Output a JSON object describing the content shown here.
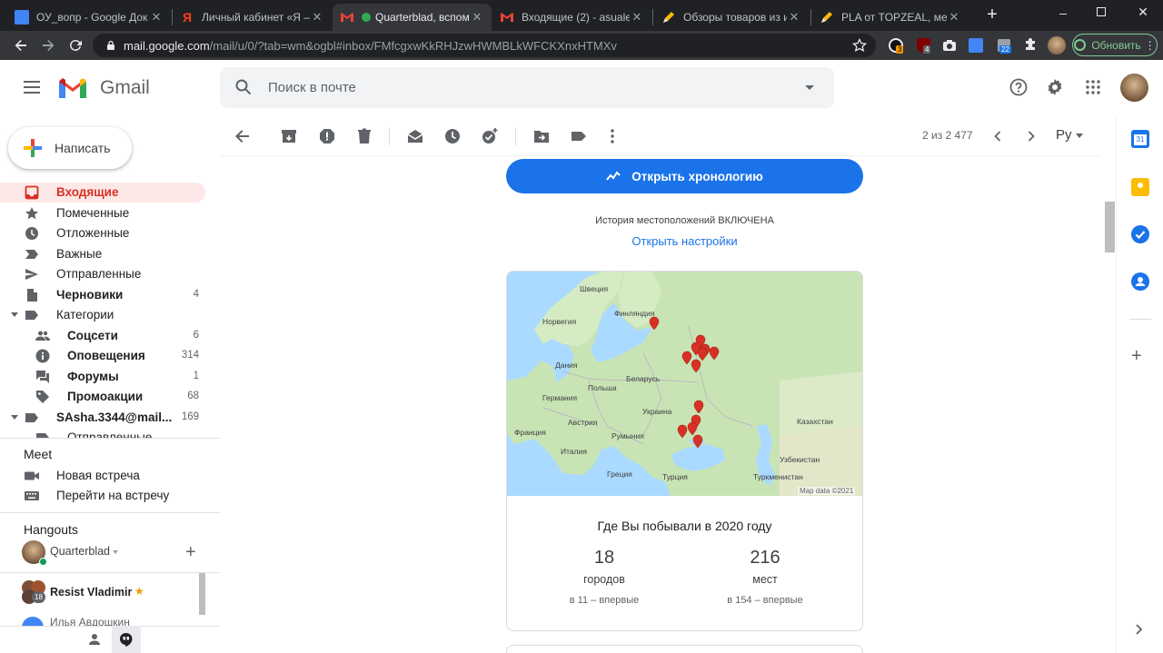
{
  "browser": {
    "tabs": [
      {
        "title": "ОУ_вопр - Google Док",
        "favicon_color": "#4285f4",
        "active": false
      },
      {
        "title": "Личный кабинет «Я —",
        "favicon_color": "#fc3f1d",
        "active": false
      },
      {
        "title": "Quarterblad, вспом",
        "favicon_color": "#ea4335",
        "active": true
      },
      {
        "title": "Входящие (2) - asualex",
        "favicon_color": "#ea4335",
        "active": false
      },
      {
        "title": "Обзоры товаров из ин",
        "favicon_color": "#fbbc04",
        "active": false
      },
      {
        "title": "PLA от TOPZEAL, меня",
        "favicon_color": "#fbbc04",
        "active": false
      }
    ],
    "url_host": "mail.google.com",
    "url_path": "/mail/u/0/?tab=wm&ogbl#inbox/FMfcgxwKkRHJzwHWMBLkWFCKXnxHTMXv",
    "ext_badges": {
      "ext1": "3",
      "ext2": "4",
      "ext3": "22"
    },
    "update_label": "Обновить"
  },
  "gmail": {
    "logo_text": "Gmail",
    "search_placeholder": "Поиск в почте"
  },
  "sidebar": {
    "compose_label": "Написать",
    "items": [
      {
        "label": "Входящие",
        "count": "",
        "icon": "inbox-icon",
        "active": true
      },
      {
        "label": "Помеченные",
        "count": "",
        "icon": "star-icon"
      },
      {
        "label": "Отложенные",
        "count": "",
        "icon": "clock-icon"
      },
      {
        "label": "Важные",
        "count": "",
        "icon": "important-icon"
      },
      {
        "label": "Отправленные",
        "count": "",
        "icon": "send-icon"
      },
      {
        "label": "Черновики",
        "count": "4",
        "icon": "draft-icon",
        "bold": true
      },
      {
        "label": "Категории",
        "count": "",
        "icon": "label-icon"
      },
      {
        "label": "Соцсети",
        "count": "6",
        "icon": "people-icon",
        "bold": true
      },
      {
        "label": "Оповещения",
        "count": "314",
        "icon": "info-icon",
        "bold": true
      },
      {
        "label": "Форумы",
        "count": "1",
        "icon": "forum-icon",
        "bold": true
      },
      {
        "label": "Промоакции",
        "count": "68",
        "icon": "tag-icon",
        "bold": true
      },
      {
        "label": "SAsha.3344@mail...",
        "count": "169",
        "icon": "label-icon",
        "bold": true
      },
      {
        "label": "Отправленные",
        "count": "",
        "icon": "label-icon"
      }
    ],
    "meet_title": "Meet",
    "meet_items": [
      "Новая встреча",
      "Перейти на встречу"
    ],
    "hangouts_title": "Hangouts",
    "hangouts_user": "Quarterblad",
    "hangouts_contacts": [
      {
        "name": "Resist Vladimir",
        "badge": "18"
      },
      {
        "name": "Илья Авдошкин"
      }
    ]
  },
  "toolbar": {
    "pagination": "2 из 2 477",
    "lang": "Ру"
  },
  "message": {
    "timeline_button": "Открыть хронологию",
    "history_status": "История местоположений ВКЛЮЧЕНА",
    "settings_link": "Открыть настройки",
    "map": {
      "labels": [
        "Швеция",
        "Норвегия",
        "Финляндия",
        "Дания",
        "Беларусь",
        "Польша",
        "Германия",
        "Украина",
        "Франция",
        "Австрия",
        "Румыния",
        "Италия",
        "Греция",
        "Турция",
        "Казахстан",
        "Узбекистан",
        "Туркменистан"
      ],
      "attribution": "Map data ©2021",
      "pin_color": "#d93025"
    },
    "card_title": "Где Вы побывали в 2020 году",
    "stats": [
      {
        "value": "18",
        "unit": "городов",
        "note": "в 11 – впервые"
      },
      {
        "value": "216",
        "unit": "мест",
        "note": "в 154 – впервые"
      }
    ]
  }
}
